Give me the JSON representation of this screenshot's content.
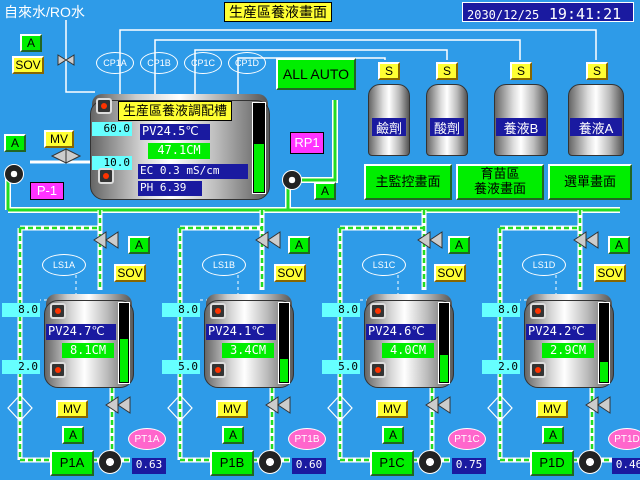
{
  "header": {
    "water_source": "自來水/RO水",
    "title": "生産區養液畫面",
    "date": "2030/12/25",
    "time": "19:41:21"
  },
  "main_tank": {
    "title": "生産區養液調配槽",
    "sp_high": "60.0",
    "sp_low": "10.0",
    "pv_label": "PV",
    "pv_temp": "24.5℃",
    "level": "47.1CM",
    "ec_label": "EC",
    "ec_value": "0.3",
    "ec_unit": "mS/cm",
    "ph_label": "PH",
    "ph_value": "6.39",
    "level_fill": 0.55
  },
  "buttons": {
    "all_auto": "ALL AUTO",
    "main_monitor": "主監控畫面",
    "nursery": "育苗區\n養液畫面",
    "menu": "選單畫面",
    "a": "A",
    "s": "S",
    "sov": "SOV",
    "mv": "MV",
    "rp1": "RP1",
    "p1": "P-1"
  },
  "chemicals": [
    {
      "label": "鹼劑"
    },
    {
      "label": "酸劑"
    },
    {
      "label": "養液B"
    },
    {
      "label": "養液A"
    }
  ],
  "feed_pumps": [
    "CP1A",
    "CP1B",
    "CP1C",
    "CP1D"
  ],
  "tanks": [
    {
      "ls": "LS1A",
      "pump": "P1A",
      "pt": "PT1A",
      "pressure": "0.63",
      "sp_high": "8.0",
      "sp_low": "2.0",
      "pv": "24.7℃",
      "level": "8.1CM",
      "fill": 0.55
    },
    {
      "ls": "LS1B",
      "pump": "P1B",
      "pt": "PT1B",
      "pressure": "0.60",
      "sp_high": "8.0",
      "sp_low": "5.0",
      "pv": "24.1℃",
      "level": "3.4CM",
      "fill": 0.3
    },
    {
      "ls": "LS1C",
      "pump": "P1C",
      "pt": "PT1C",
      "pressure": "0.75",
      "sp_high": "8.0",
      "sp_low": "5.0",
      "pv": "24.6℃",
      "level": "4.0CM",
      "fill": 0.35
    },
    {
      "ls": "LS1D",
      "pump": "P1D",
      "pt": "PT1D",
      "pressure": "0.46",
      "sp_high": "8.0",
      "sp_low": "2.0",
      "pv": "24.2℃",
      "level": "2.9CM",
      "fill": 0.25
    }
  ],
  "colors": {
    "background": "#2e9be8",
    "button_green": "#00ee00",
    "label_yellow": "#ffff33",
    "value_blue": "#1a1aa0",
    "cyan": "#66ffff",
    "magenta": "#ff33ff",
    "pink": "#ff66cc"
  }
}
